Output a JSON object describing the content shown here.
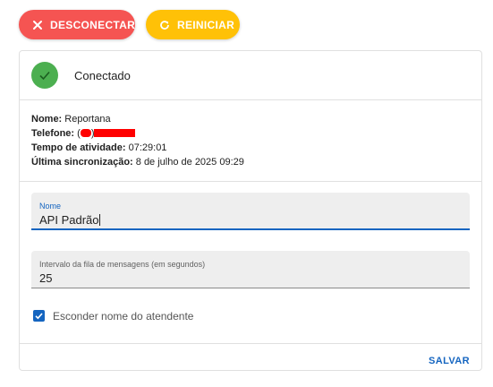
{
  "toolbar": {
    "disconnect_label": "DESCONECTAR",
    "restart_label": "REINICIAR"
  },
  "status": {
    "label": "Conectado",
    "color": "#4caf50"
  },
  "info": {
    "name_label": "Nome:",
    "name_value": "Reportana",
    "phone_label": "Telefone:",
    "phone_prefix": "(",
    "phone_mid": ")",
    "uptime_label": "Tempo de atividade:",
    "uptime_value": "07:29:01",
    "sync_label": "Última sincronização:",
    "sync_value": "8 de julho de 2025 09:29"
  },
  "form": {
    "name_label": "Nome",
    "name_value": "API Padrão",
    "interval_label": "Intervalo da fila de mensagens (em segundos)",
    "interval_value": "25",
    "hide_agent_label": "Esconder nome do atendente",
    "hide_agent_checked": true
  },
  "footer": {
    "save_label": "SALVAR"
  },
  "colors": {
    "disconnect": "#f55452",
    "restart": "#ffc107",
    "primary": "#1565c0"
  }
}
